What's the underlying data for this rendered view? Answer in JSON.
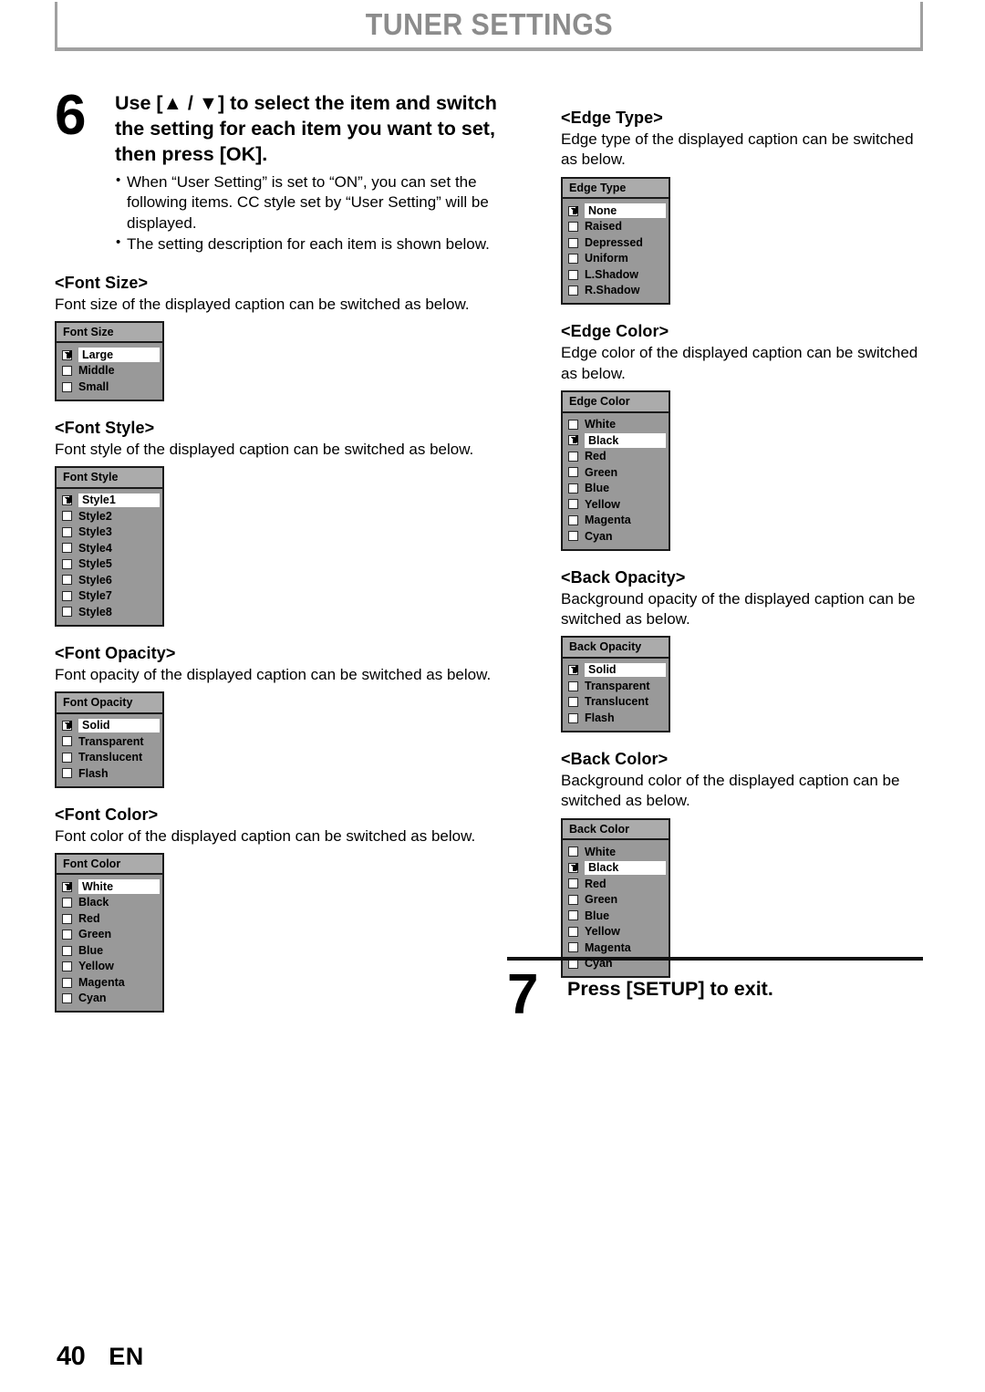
{
  "page": {
    "title": "TUNER SETTINGS",
    "number": "40",
    "language": "EN",
    "title_color": "#8c8c8c"
  },
  "step6": {
    "number": "6",
    "heading": "Use [▲ / ▼] to select the item and switch the setting for each item you want to set, then press [OK].",
    "bullets": [
      "When “User Setting” is set to “ON”, you can set the following items. CC style set by “User Setting” will be displayed.",
      "The setting description for each item is shown below."
    ]
  },
  "step7": {
    "number": "7",
    "heading": "Press [SETUP] to exit."
  },
  "osd_colors": {
    "body": "#999999",
    "header": "#ababab",
    "border": "#1a1a1a",
    "highlight": "#ffffff"
  },
  "left_column": [
    {
      "title": "<Font Size>",
      "description": "Font size of the displayed caption can be switched as below.",
      "menu_title": "Font Size",
      "options": [
        {
          "label": "Large",
          "checked": true
        },
        {
          "label": "Middle",
          "checked": false
        },
        {
          "label": "Small",
          "checked": false
        }
      ]
    },
    {
      "title": "<Font Style>",
      "description": "Font style of the displayed caption can be switched as below.",
      "menu_title": "Font Style",
      "options": [
        {
          "label": "Style1",
          "checked": true
        },
        {
          "label": "Style2",
          "checked": false
        },
        {
          "label": "Style3",
          "checked": false
        },
        {
          "label": "Style4",
          "checked": false
        },
        {
          "label": "Style5",
          "checked": false
        },
        {
          "label": "Style6",
          "checked": false
        },
        {
          "label": "Style7",
          "checked": false
        },
        {
          "label": "Style8",
          "checked": false
        }
      ]
    },
    {
      "title": "<Font Opacity>",
      "description": "Font opacity of the displayed caption can be switched as below.",
      "menu_title": "Font Opacity",
      "options": [
        {
          "label": "Solid",
          "checked": true
        },
        {
          "label": "Transparent",
          "checked": false
        },
        {
          "label": "Translucent",
          "checked": false
        },
        {
          "label": "Flash",
          "checked": false
        }
      ]
    },
    {
      "title": "<Font Color>",
      "description": "Font color of the displayed caption can be switched as below.",
      "menu_title": "Font Color",
      "options": [
        {
          "label": "White",
          "checked": true
        },
        {
          "label": "Black",
          "checked": false
        },
        {
          "label": "Red",
          "checked": false
        },
        {
          "label": "Green",
          "checked": false
        },
        {
          "label": "Blue",
          "checked": false
        },
        {
          "label": "Yellow",
          "checked": false
        },
        {
          "label": "Magenta",
          "checked": false
        },
        {
          "label": "Cyan",
          "checked": false
        }
      ]
    }
  ],
  "right_column": [
    {
      "title": "<Edge Type>",
      "description": "Edge type of the displayed caption can be switched as below.",
      "menu_title": "Edge Type",
      "options": [
        {
          "label": "None",
          "checked": true
        },
        {
          "label": "Raised",
          "checked": false
        },
        {
          "label": "Depressed",
          "checked": false
        },
        {
          "label": "Uniform",
          "checked": false
        },
        {
          "label": "L.Shadow",
          "checked": false
        },
        {
          "label": "R.Shadow",
          "checked": false
        }
      ]
    },
    {
      "title": "<Edge Color>",
      "description": "Edge color of the displayed caption can be switched as below.",
      "menu_title": "Edge Color",
      "options": [
        {
          "label": "White",
          "checked": false
        },
        {
          "label": "Black",
          "checked": true
        },
        {
          "label": "Red",
          "checked": false
        },
        {
          "label": "Green",
          "checked": false
        },
        {
          "label": "Blue",
          "checked": false
        },
        {
          "label": "Yellow",
          "checked": false
        },
        {
          "label": "Magenta",
          "checked": false
        },
        {
          "label": "Cyan",
          "checked": false
        }
      ]
    },
    {
      "title": "<Back Opacity>",
      "description": "Background opacity of the displayed caption can be switched as below.",
      "menu_title": "Back Opacity",
      "options": [
        {
          "label": "Solid",
          "checked": true
        },
        {
          "label": "Transparent",
          "checked": false
        },
        {
          "label": "Translucent",
          "checked": false
        },
        {
          "label": "Flash",
          "checked": false
        }
      ]
    },
    {
      "title": "<Back Color>",
      "description": "Background color of the displayed caption can be switched as below.",
      "menu_title": "Back Color",
      "options": [
        {
          "label": "White",
          "checked": false
        },
        {
          "label": "Black",
          "checked": true
        },
        {
          "label": "Red",
          "checked": false
        },
        {
          "label": "Green",
          "checked": false
        },
        {
          "label": "Blue",
          "checked": false
        },
        {
          "label": "Yellow",
          "checked": false
        },
        {
          "label": "Magenta",
          "checked": false
        },
        {
          "label": "Cyan",
          "checked": false
        }
      ]
    }
  ]
}
